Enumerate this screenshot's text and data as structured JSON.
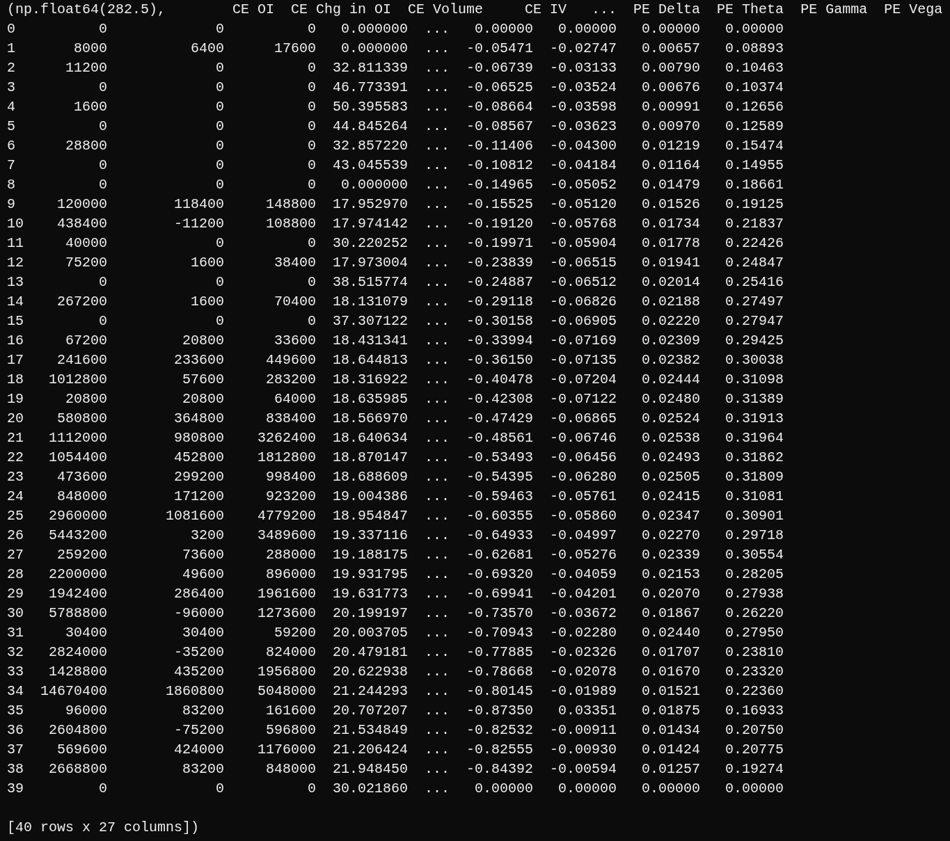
{
  "header": [
    "(np.float64(282.5),",
    "CE OI",
    "CE Chg in OI",
    "CE Volume",
    "CE IV",
    "...",
    "PE Delta",
    "PE Theta",
    "PE Gamma",
    "PE Vega"
  ],
  "rows": [
    [
      "0",
      "0",
      "0",
      "0",
      "0.000000",
      "...",
      "0.00000",
      "0.00000",
      "0.00000",
      "0.00000"
    ],
    [
      "1",
      "8000",
      "6400",
      "17600",
      "0.000000",
      "...",
      "-0.05471",
      "-0.02747",
      "0.00657",
      "0.08893"
    ],
    [
      "2",
      "11200",
      "0",
      "0",
      "32.811339",
      "...",
      "-0.06739",
      "-0.03133",
      "0.00790",
      "0.10463"
    ],
    [
      "3",
      "0",
      "0",
      "0",
      "46.773391",
      "...",
      "-0.06525",
      "-0.03524",
      "0.00676",
      "0.10374"
    ],
    [
      "4",
      "1600",
      "0",
      "0",
      "50.395583",
      "...",
      "-0.08664",
      "-0.03598",
      "0.00991",
      "0.12656"
    ],
    [
      "5",
      "0",
      "0",
      "0",
      "44.845264",
      "...",
      "-0.08567",
      "-0.03623",
      "0.00970",
      "0.12589"
    ],
    [
      "6",
      "28800",
      "0",
      "0",
      "32.857220",
      "...",
      "-0.11406",
      "-0.04300",
      "0.01219",
      "0.15474"
    ],
    [
      "7",
      "0",
      "0",
      "0",
      "43.045539",
      "...",
      "-0.10812",
      "-0.04184",
      "0.01164",
      "0.14955"
    ],
    [
      "8",
      "0",
      "0",
      "0",
      "0.000000",
      "...",
      "-0.14965",
      "-0.05052",
      "0.01479",
      "0.18661"
    ],
    [
      "9",
      "120000",
      "118400",
      "148800",
      "17.952970",
      "...",
      "-0.15525",
      "-0.05120",
      "0.01526",
      "0.19125"
    ],
    [
      "10",
      "438400",
      "-11200",
      "108800",
      "17.974142",
      "...",
      "-0.19120",
      "-0.05768",
      "0.01734",
      "0.21837"
    ],
    [
      "11",
      "40000",
      "0",
      "0",
      "30.220252",
      "...",
      "-0.19971",
      "-0.05904",
      "0.01778",
      "0.22426"
    ],
    [
      "12",
      "75200",
      "1600",
      "38400",
      "17.973004",
      "...",
      "-0.23839",
      "-0.06515",
      "0.01941",
      "0.24847"
    ],
    [
      "13",
      "0",
      "0",
      "0",
      "38.515774",
      "...",
      "-0.24887",
      "-0.06512",
      "0.02014",
      "0.25416"
    ],
    [
      "14",
      "267200",
      "1600",
      "70400",
      "18.131079",
      "...",
      "-0.29118",
      "-0.06826",
      "0.02188",
      "0.27497"
    ],
    [
      "15",
      "0",
      "0",
      "0",
      "37.307122",
      "...",
      "-0.30158",
      "-0.06905",
      "0.02220",
      "0.27947"
    ],
    [
      "16",
      "67200",
      "20800",
      "33600",
      "18.431341",
      "...",
      "-0.33994",
      "-0.07169",
      "0.02309",
      "0.29425"
    ],
    [
      "17",
      "241600",
      "233600",
      "449600",
      "18.644813",
      "...",
      "-0.36150",
      "-0.07135",
      "0.02382",
      "0.30038"
    ],
    [
      "18",
      "1012800",
      "57600",
      "283200",
      "18.316922",
      "...",
      "-0.40478",
      "-0.07204",
      "0.02444",
      "0.31098"
    ],
    [
      "19",
      "20800",
      "20800",
      "64000",
      "18.635985",
      "...",
      "-0.42308",
      "-0.07122",
      "0.02480",
      "0.31389"
    ],
    [
      "20",
      "580800",
      "364800",
      "838400",
      "18.566970",
      "...",
      "-0.47429",
      "-0.06865",
      "0.02524",
      "0.31913"
    ],
    [
      "21",
      "1112000",
      "980800",
      "3262400",
      "18.640634",
      "...",
      "-0.48561",
      "-0.06746",
      "0.02538",
      "0.31964"
    ],
    [
      "22",
      "1054400",
      "452800",
      "1812800",
      "18.870147",
      "...",
      "-0.53493",
      "-0.06456",
      "0.02493",
      "0.31862"
    ],
    [
      "23",
      "473600",
      "299200",
      "998400",
      "18.688609",
      "...",
      "-0.54395",
      "-0.06280",
      "0.02505",
      "0.31809"
    ],
    [
      "24",
      "848000",
      "171200",
      "923200",
      "19.004386",
      "...",
      "-0.59463",
      "-0.05761",
      "0.02415",
      "0.31081"
    ],
    [
      "25",
      "2960000",
      "1081600",
      "4779200",
      "18.954847",
      "...",
      "-0.60355",
      "-0.05860",
      "0.02347",
      "0.30901"
    ],
    [
      "26",
      "5443200",
      "3200",
      "3489600",
      "19.337116",
      "...",
      "-0.64933",
      "-0.04997",
      "0.02270",
      "0.29718"
    ],
    [
      "27",
      "259200",
      "73600",
      "288000",
      "19.188175",
      "...",
      "-0.62681",
      "-0.05276",
      "0.02339",
      "0.30554"
    ],
    [
      "28",
      "2200000",
      "49600",
      "896000",
      "19.931795",
      "...",
      "-0.69320",
      "-0.04059",
      "0.02153",
      "0.28205"
    ],
    [
      "29",
      "1942400",
      "286400",
      "1961600",
      "19.631773",
      "...",
      "-0.69941",
      "-0.04201",
      "0.02070",
      "0.27938"
    ],
    [
      "30",
      "5788800",
      "-96000",
      "1273600",
      "20.199197",
      "...",
      "-0.73570",
      "-0.03672",
      "0.01867",
      "0.26220"
    ],
    [
      "31",
      "30400",
      "30400",
      "59200",
      "20.003705",
      "...",
      "-0.70943",
      "-0.02280",
      "0.02440",
      "0.27950"
    ],
    [
      "32",
      "2824000",
      "-35200",
      "824000",
      "20.479181",
      "...",
      "-0.77885",
      "-0.02326",
      "0.01707",
      "0.23810"
    ],
    [
      "33",
      "1428800",
      "435200",
      "1956800",
      "20.622938",
      "...",
      "-0.78668",
      "-0.02078",
      "0.01670",
      "0.23320"
    ],
    [
      "34",
      "14670400",
      "1860800",
      "5048000",
      "21.244293",
      "...",
      "-0.80145",
      "-0.01989",
      "0.01521",
      "0.22360"
    ],
    [
      "35",
      "96000",
      "83200",
      "161600",
      "20.707207",
      "...",
      "-0.87350",
      "0.03351",
      "0.01875",
      "0.16933"
    ],
    [
      "36",
      "2604800",
      "-75200",
      "596800",
      "21.534849",
      "...",
      "-0.82532",
      "-0.00911",
      "0.01434",
      "0.20750"
    ],
    [
      "37",
      "569600",
      "424000",
      "1176000",
      "21.206424",
      "...",
      "-0.82555",
      "-0.00930",
      "0.01424",
      "0.20775"
    ],
    [
      "38",
      "2668800",
      "83200",
      "848000",
      "21.948450",
      "...",
      "-0.84392",
      "-0.00594",
      "0.01257",
      "0.19274"
    ],
    [
      "39",
      "0",
      "0",
      "0",
      "30.021860",
      "...",
      "0.00000",
      "0.00000",
      "0.00000",
      "0.00000"
    ]
  ],
  "footer": "[40 rows x 27 columns])"
}
